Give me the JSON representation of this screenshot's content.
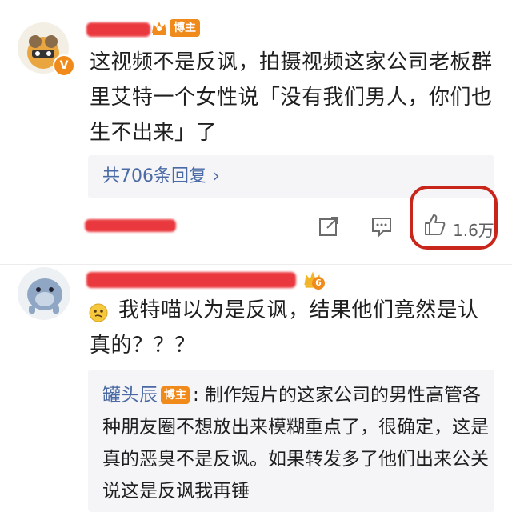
{
  "comment1": {
    "badge_label": "博主",
    "verified_label": "V",
    "text": "这视频不是反讽，拍摄视频这家公司老板群里艾特一个女性说「没有我们男人，你们也生不出来」了",
    "reply_link": "共706条回复",
    "reply_chevron": "›",
    "like_count": "1.6万"
  },
  "comment2": {
    "level_label": "6",
    "text": "我特喵以为是反讽，结果他们竟然是认真的？？？",
    "quote": {
      "author": "罐头辰",
      "badge_label": "博主",
      "text": ": 制作短片的这家公司的男性高管各种朋友圈不想放出来模糊重点了，很确定，这是真的恶臭不是反讽。如果转发多了他们出来公关说这是反讽我再锤"
    }
  },
  "colors": {
    "accent_link": "#4a6aa5",
    "badge_orange": "#f08a1a",
    "annotation_red": "#c8261b",
    "redaction_red": "#e8292f"
  },
  "icons": [
    "share-icon",
    "comment-icon",
    "like-icon",
    "crown-icon",
    "emoji-icon"
  ]
}
